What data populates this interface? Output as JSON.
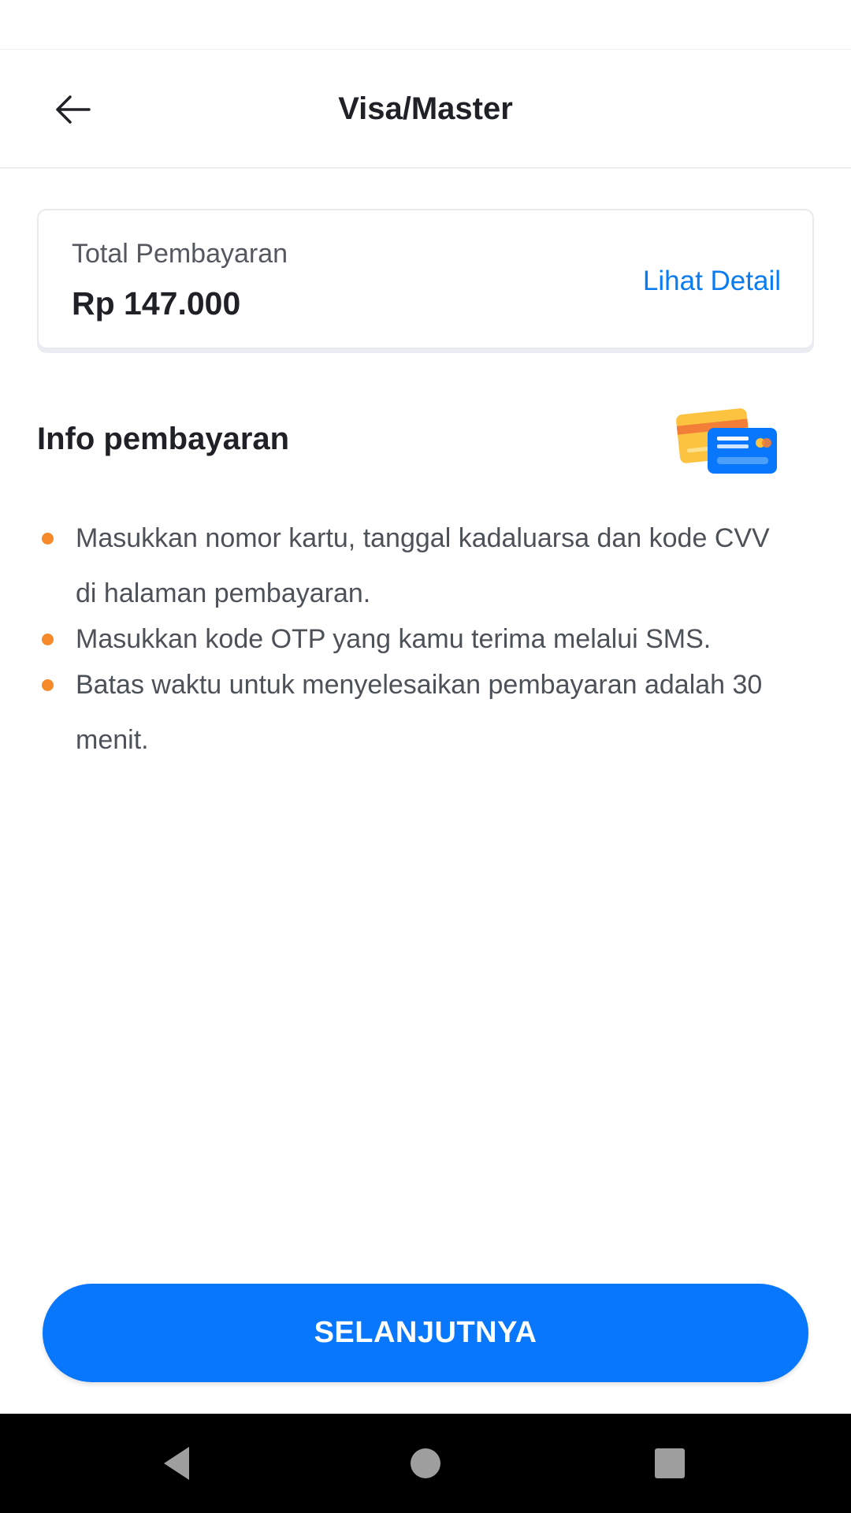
{
  "header": {
    "title": "Visa/Master",
    "back_icon": "arrow-left-icon"
  },
  "payment_total": {
    "label": "Total Pembayaran",
    "amount": "Rp 147.000",
    "detail_link": "Lihat Detail"
  },
  "info": {
    "title": "Info pembayaran",
    "icon": "credit-card-icon",
    "items": [
      "Masukkan nomor kartu, tanggal kadaluarsa dan kode CVV di halaman pembayaran.",
      "Masukkan kode OTP yang kamu terima melalui SMS.",
      "Batas waktu untuk menyelesaikan pembayaran adalah 30 menit."
    ]
  },
  "actions": {
    "next_label": "SELANJUTNYA"
  },
  "nav": {
    "back_icon": "nav-back-icon",
    "home_icon": "nav-home-icon",
    "recents_icon": "nav-recents-icon"
  },
  "colors": {
    "accent": "#0977fb",
    "link": "#0a7cf2",
    "bullet": "#f58a2b"
  }
}
